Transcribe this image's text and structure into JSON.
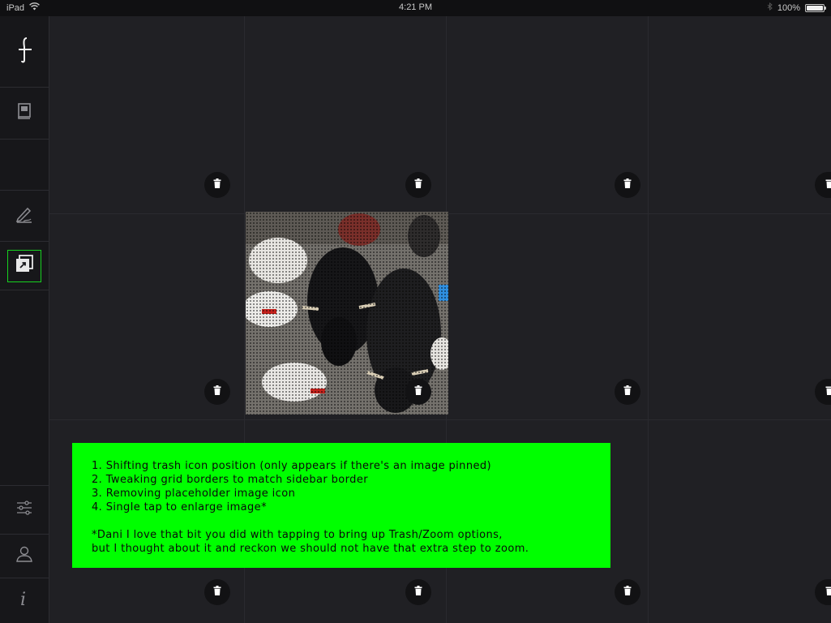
{
  "status_bar": {
    "device": "iPad",
    "time": "4:21 PM",
    "battery": "100%",
    "battery_level": 1.0,
    "icons": [
      "wifi-icon",
      "bluetooth-icon",
      "battery-icon"
    ]
  },
  "sidebar": {
    "top_items": [
      {
        "icon": "add-icon",
        "active": false
      },
      {
        "icon": "book-icon",
        "active": false
      },
      {
        "icon": "empty-slot",
        "active": false
      },
      {
        "icon": "pen-icon",
        "active": false
      },
      {
        "icon": "gallery-zoom-icon",
        "active": true
      }
    ],
    "bottom_items": [
      {
        "icon": "sliders-icon"
      },
      {
        "icon": "profile-icon"
      },
      {
        "icon": "info-icon"
      }
    ],
    "accent_color": "#17d21f"
  },
  "grid": {
    "trash_icon": "trash-icon",
    "pinned_image": {
      "description_icon": "pinned-image",
      "present": true
    }
  },
  "note": {
    "background": "#00ff00",
    "items": [
      "1. Shifting trash icon position (only appears if there's an image pinned)",
      "2. Tweaking grid borders to match sidebar border",
      "3. Removing placeholder image icon",
      "4. Single tap to enlarge image*"
    ],
    "footnote_1": "*Dani I love that bit you did with tapping to bring up Trash/Zoom options,",
    "footnote_2": "but I thought about it and reckon we should not have that extra step to zoom."
  }
}
